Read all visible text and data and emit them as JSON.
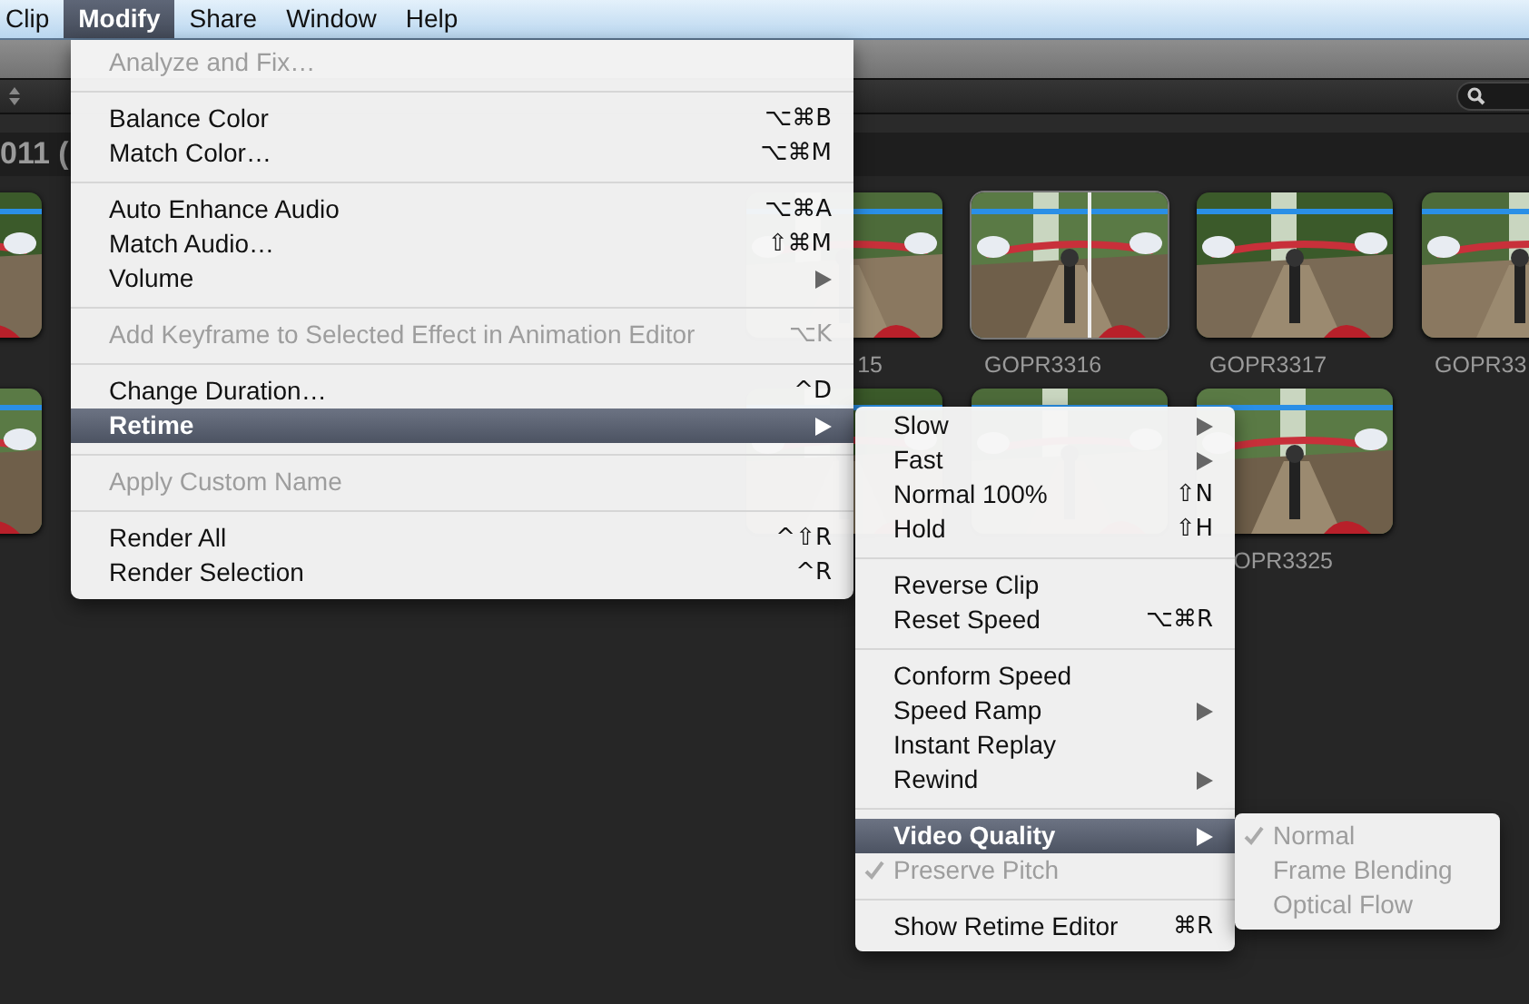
{
  "menu_bar": [
    {
      "label": "Clip",
      "selected": false
    },
    {
      "label": "Modify",
      "selected": true
    },
    {
      "label": "Share",
      "selected": false
    },
    {
      "label": "Window",
      "selected": false
    },
    {
      "label": "Help",
      "selected": false
    }
  ],
  "browser": {
    "event_title": "011 (",
    "clip_rows": [
      [
        {
          "skimmed": false
        },
        {
          "label": "15",
          "cut_start": true,
          "skimmed": false
        },
        {
          "label": "GOPR3316",
          "cut_start": false,
          "skimmed": true
        },
        {
          "label": "GOPR3317",
          "cut_start": false,
          "skimmed": false
        },
        {
          "label": "GOPR33",
          "cut_start": false,
          "skimmed": false
        }
      ],
      [
        {
          "skimmed": false
        },
        {
          "skimmed": false
        },
        {
          "skimmed": false
        },
        {
          "label": "OPR3325",
          "cut_start": true,
          "skimmed": false
        }
      ]
    ]
  },
  "modify_menu": [
    {
      "kind": "item",
      "label": "Analyze and Fix…",
      "disabled": true,
      "selected": false,
      "submenu": false,
      "checked": false
    },
    {
      "kind": "separator"
    },
    {
      "kind": "item",
      "label": "Balance Color",
      "shortcut": "⌥⌘B",
      "disabled": false,
      "selected": false,
      "submenu": false,
      "checked": false
    },
    {
      "kind": "item",
      "label": "Match Color…",
      "shortcut": "⌥⌘M",
      "disabled": false,
      "selected": false,
      "submenu": false,
      "checked": false
    },
    {
      "kind": "separator"
    },
    {
      "kind": "item",
      "label": "Auto Enhance Audio",
      "shortcut": "⌥⌘A",
      "disabled": false,
      "selected": false,
      "submenu": false,
      "checked": false
    },
    {
      "kind": "item",
      "label": "Match Audio…",
      "shortcut": "⇧⌘M",
      "disabled": false,
      "selected": false,
      "submenu": false,
      "checked": false
    },
    {
      "kind": "item",
      "label": "Volume",
      "disabled": false,
      "selected": false,
      "submenu": true,
      "checked": false
    },
    {
      "kind": "separator"
    },
    {
      "kind": "item",
      "label": "Add Keyframe to Selected Effect in Animation Editor",
      "shortcut": "⌥K",
      "disabled": true,
      "selected": false,
      "submenu": false,
      "checked": false
    },
    {
      "kind": "separator"
    },
    {
      "kind": "item",
      "label": "Change Duration…",
      "shortcut": "^D",
      "disabled": false,
      "selected": false,
      "submenu": false,
      "checked": false
    },
    {
      "kind": "item",
      "label": "Retime",
      "disabled": false,
      "selected": true,
      "submenu": true,
      "checked": false
    },
    {
      "kind": "separator"
    },
    {
      "kind": "item",
      "label": "Apply Custom Name",
      "disabled": true,
      "selected": false,
      "submenu": false,
      "checked": false
    },
    {
      "kind": "separator"
    },
    {
      "kind": "item",
      "label": "Render All",
      "shortcut": "^⇧R",
      "disabled": false,
      "selected": false,
      "submenu": false,
      "checked": false
    },
    {
      "kind": "item",
      "label": "Render Selection",
      "shortcut": "^R",
      "disabled": false,
      "selected": false,
      "submenu": false,
      "checked": false
    }
  ],
  "retime_menu": [
    {
      "kind": "item",
      "label": "Slow",
      "disabled": false,
      "selected": false,
      "submenu": true,
      "checked": false
    },
    {
      "kind": "item",
      "label": "Fast",
      "disabled": false,
      "selected": false,
      "submenu": true,
      "checked": false
    },
    {
      "kind": "item",
      "label": "Normal 100%",
      "shortcut": "⇧N",
      "disabled": false,
      "selected": false,
      "submenu": false,
      "checked": false
    },
    {
      "kind": "item",
      "label": "Hold",
      "shortcut": "⇧H",
      "disabled": false,
      "selected": false,
      "submenu": false,
      "checked": false
    },
    {
      "kind": "separator"
    },
    {
      "kind": "item",
      "label": "Reverse Clip",
      "disabled": false,
      "selected": false,
      "submenu": false,
      "checked": false
    },
    {
      "kind": "item",
      "label": "Reset Speed",
      "shortcut": "⌥⌘R",
      "disabled": false,
      "selected": false,
      "submenu": false,
      "checked": false
    },
    {
      "kind": "separator"
    },
    {
      "kind": "item",
      "label": "Conform Speed",
      "disabled": false,
      "selected": false,
      "submenu": false,
      "checked": false
    },
    {
      "kind": "item",
      "label": "Speed Ramp",
      "disabled": false,
      "selected": false,
      "submenu": true,
      "checked": false
    },
    {
      "kind": "item",
      "label": "Instant Replay",
      "disabled": false,
      "selected": false,
      "submenu": false,
      "checked": false
    },
    {
      "kind": "item",
      "label": "Rewind",
      "disabled": false,
      "selected": false,
      "submenu": true,
      "checked": false
    },
    {
      "kind": "separator"
    },
    {
      "kind": "item",
      "label": "Video Quality",
      "disabled": false,
      "selected": true,
      "submenu": true,
      "checked": false
    },
    {
      "kind": "item",
      "label": "Preserve Pitch",
      "disabled": true,
      "selected": false,
      "submenu": false,
      "checked": true
    },
    {
      "kind": "separator"
    },
    {
      "kind": "item",
      "label": "Show Retime Editor",
      "shortcut": "⌘R",
      "disabled": false,
      "selected": false,
      "submenu": false,
      "checked": false
    }
  ],
  "video_quality_menu": [
    {
      "kind": "item",
      "label": "Normal",
      "disabled": true,
      "selected": false,
      "submenu": false,
      "checked": true
    },
    {
      "kind": "item",
      "label": "Frame Blending",
      "disabled": true,
      "selected": false,
      "submenu": false,
      "checked": false
    },
    {
      "kind": "item",
      "label": "Optical Flow",
      "disabled": true,
      "selected": false,
      "submenu": false,
      "checked": false
    }
  ]
}
